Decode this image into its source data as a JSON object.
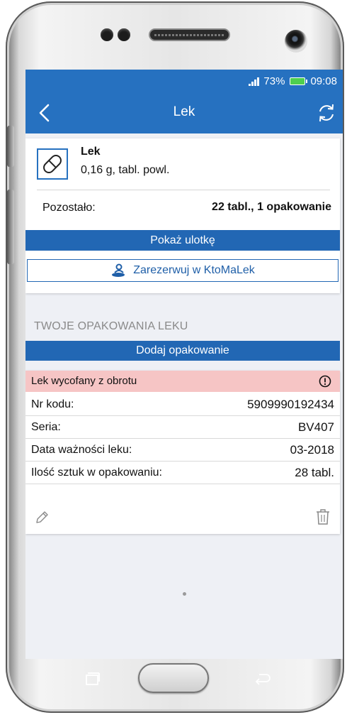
{
  "status_bar": {
    "battery": "73%",
    "time": "09:08"
  },
  "app_bar": {
    "title": "Lek"
  },
  "drug": {
    "name": "Lek",
    "description": "0,16 g, tabl. powl.",
    "remaining_label": "Pozostało:",
    "remaining_value": "22 tabl., 1 opakowanie",
    "leaflet_button": "Pokaż ulotkę",
    "reserve_button": "Zarezerwuj w KtoMaLek"
  },
  "packages": {
    "heading": "TWOJE OPAKOWANIA LEKU",
    "add_button": "Dodaj opakowanie",
    "item": {
      "alert": "Lek wycofany z obrotu",
      "rows": [
        {
          "label": "Nr kodu:",
          "value": "5909990192434"
        },
        {
          "label": "Seria:",
          "value": "BV407"
        },
        {
          "label": "Data ważności leku:",
          "value": "03-2018"
        },
        {
          "label": "Ilość sztuk w opakowaniu:",
          "value": "28 tabl."
        }
      ]
    }
  },
  "colors": {
    "primary": "#2671c0",
    "button": "#2267b4",
    "alert_background": "#f6c5c5",
    "background": "#eef0f5"
  },
  "icons": [
    "back-arrow-icon",
    "refresh-icon",
    "pill-icon",
    "person-pin-icon",
    "alert-circle-icon",
    "pencil-icon",
    "trash-icon"
  ]
}
